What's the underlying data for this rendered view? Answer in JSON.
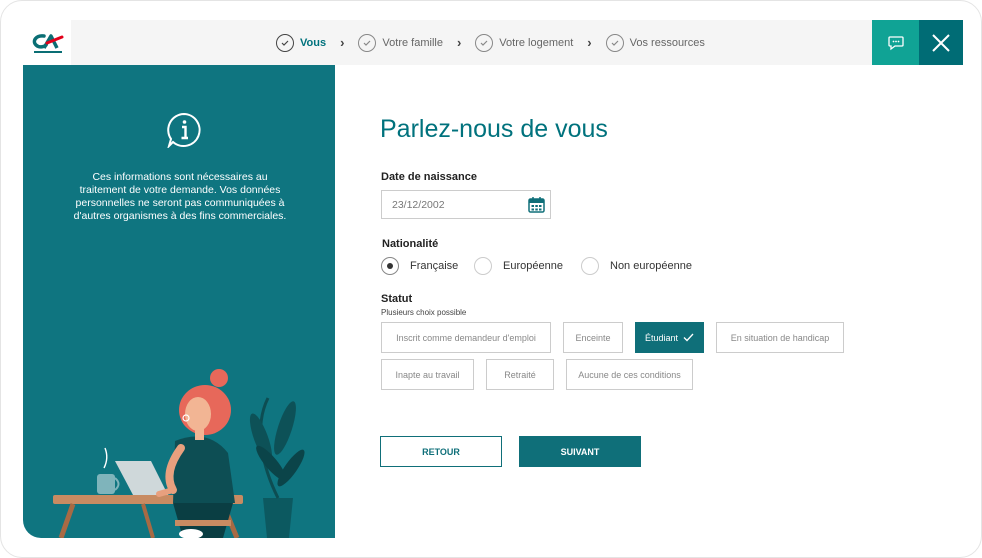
{
  "header": {
    "logo_text": "CA",
    "steps": [
      {
        "label": "Vous"
      },
      {
        "label": "Votre famille"
      },
      {
        "label": "Votre logement"
      },
      {
        "label": "Vos ressources"
      }
    ],
    "chat_icon": "chat-bubble-icon",
    "close_icon": "close-icon"
  },
  "sidebar": {
    "info_icon": "info-bubble-icon",
    "text": "Ces informations sont nécessaires au traitement de votre demande. Vos données personnelles ne seront pas communiquées à d'autres organismes à des fins commerciales."
  },
  "form": {
    "title": "Parlez-nous de vous",
    "birth": {
      "label": "Date de naissance",
      "value": "23/12/2002"
    },
    "nationality": {
      "label": "Nationalité",
      "options": [
        "Française",
        "Européenne",
        "Non européenne"
      ],
      "selected": "Française"
    },
    "status": {
      "label": "Statut",
      "sub": "Plusieurs choix possible",
      "options": [
        "Inscrit comme demandeur d'emploi",
        "Enceinte",
        "Étudiant",
        "En situation de handicap",
        "Inapte au travail",
        "Retraité",
        "Aucune de ces conditions"
      ],
      "selected": "Étudiant"
    },
    "buttons": {
      "back": "RETOUR",
      "next": "SUIVANT"
    }
  },
  "colors": {
    "accent": "#0f7580",
    "brand_green": "#10a395",
    "dark_teal": "#006c75"
  }
}
